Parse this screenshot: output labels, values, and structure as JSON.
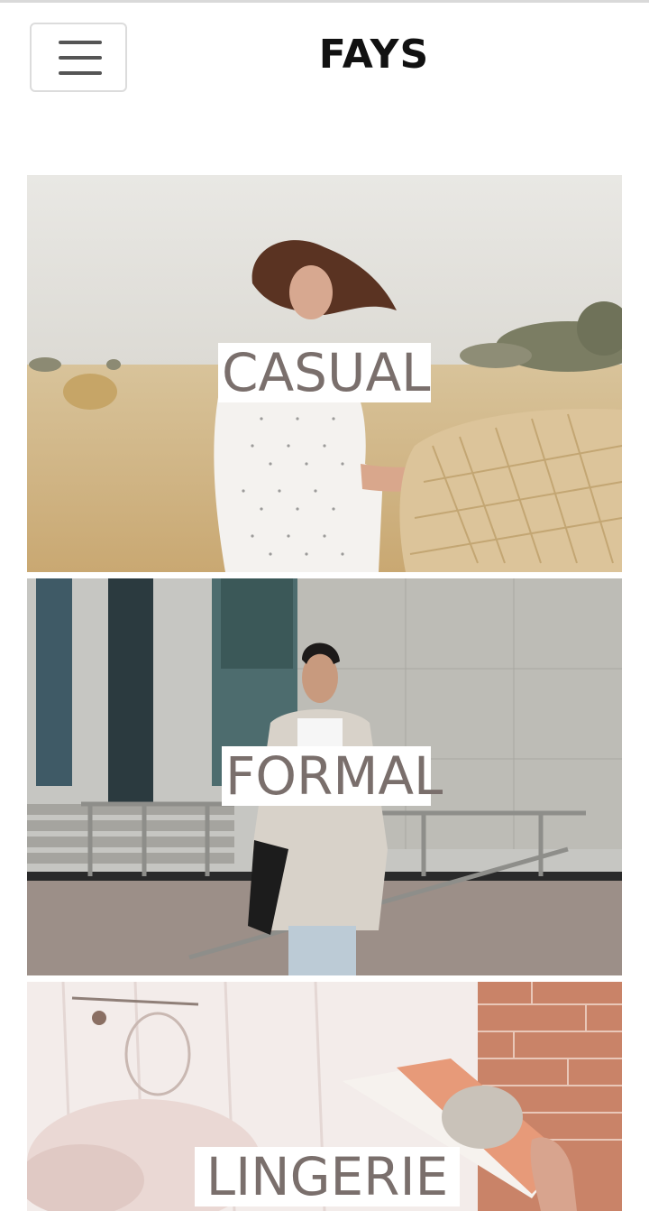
{
  "header": {
    "menu_icon": "hamburger-menu-icon",
    "logo": "FAYS"
  },
  "categories": [
    {
      "label": "CASUAL",
      "image": "woman in polka-dot outfit in wheat field with hay bale"
    },
    {
      "label": "FORMAL",
      "image": "woman in beige blazer walking by building stairs"
    },
    {
      "label": "LINGERIE",
      "image": "pink bedroom with fluffy pillow and person reading magazine"
    }
  ],
  "colors": {
    "label_text": "#7a6f6c",
    "label_bg": "#ffffff",
    "logo_text": "#111111",
    "menu_border": "#dcdcdc"
  }
}
